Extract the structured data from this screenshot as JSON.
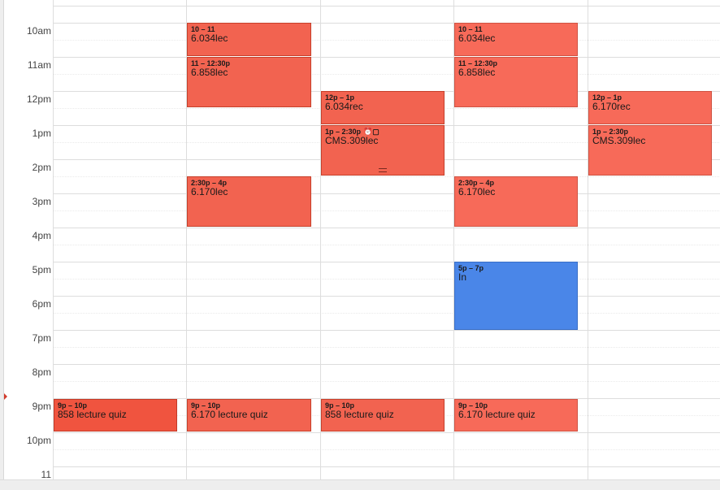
{
  "time_labels": [
    "10am",
    "11am",
    "12pm",
    "1pm",
    "2pm",
    "3pm",
    "4pm",
    "5pm",
    "6pm",
    "7pm",
    "8pm",
    "9pm",
    "10pm",
    "11"
  ],
  "events": [
    {
      "day": 1,
      "time": "10 – 11",
      "title": "6.034lec"
    },
    {
      "day": 1,
      "time": "11 – 12:30p",
      "title": "6.858lec"
    },
    {
      "day": 1,
      "time": "2:30p – 4p",
      "title": "6.170lec"
    },
    {
      "day": 1,
      "time": "9p – 10p",
      "title": "6.170 lecture quiz"
    },
    {
      "day": 0,
      "time": "9p – 10p",
      "title": "858 lecture quiz"
    },
    {
      "day": 2,
      "time": "12p – 1p",
      "title": "6.034rec"
    },
    {
      "day": 2,
      "time": "1p – 2:30p",
      "title": "CMS.309lec",
      "icons": "⏰▢"
    },
    {
      "day": 2,
      "time": "9p – 10p",
      "title": "858 lecture quiz"
    },
    {
      "day": 3,
      "time": "10 – 11",
      "title": "6.034lec"
    },
    {
      "day": 3,
      "time": "11 – 12:30p",
      "title": "6.858lec"
    },
    {
      "day": 3,
      "time": "2:30p – 4p",
      "title": "6.170lec"
    },
    {
      "day": 3,
      "time": "5p – 7p",
      "title": "In"
    },
    {
      "day": 3,
      "time": "9p – 10p",
      "title": "6.170 lecture quiz"
    },
    {
      "day": 4,
      "time": "12p – 1p",
      "title": "6.170rec"
    },
    {
      "day": 4,
      "time": "1p – 2:30p",
      "title": "CMS.309lec"
    }
  ],
  "colors": {
    "event_red": "#f26350",
    "event_red_light": "#f76a59",
    "event_blue": "#4a86e8",
    "now_marker": "#d23b2b"
  }
}
